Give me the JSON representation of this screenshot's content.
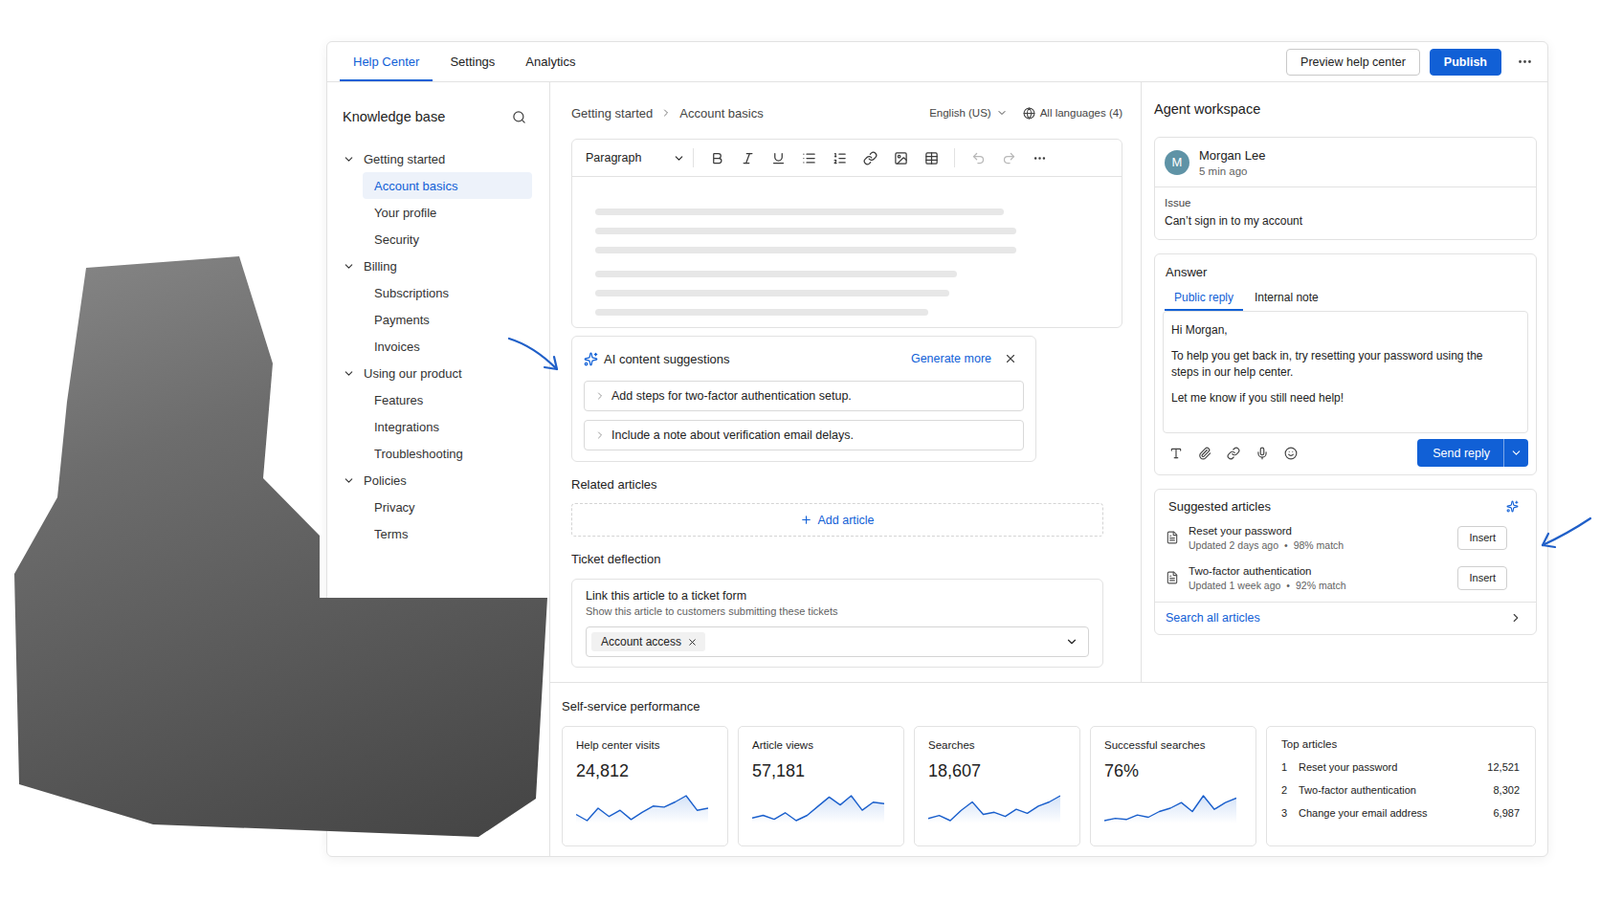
{
  "nav": {
    "tabs": [
      {
        "label": "Help Center",
        "selected": true
      },
      {
        "label": "Settings",
        "selected": false
      },
      {
        "label": "Analytics",
        "selected": false
      }
    ],
    "preview": "Preview help center",
    "publish": "Publish"
  },
  "sidebar": {
    "title": "Knowledge base",
    "groups": [
      {
        "label": "Getting started",
        "expanded": true,
        "items": [
          {
            "label": "Account basics",
            "selected": true
          },
          {
            "label": "Your profile",
            "selected": false
          },
          {
            "label": "Security",
            "selected": false
          }
        ]
      },
      {
        "label": "Billing",
        "expanded": true,
        "items": [
          {
            "label": "Subscriptions",
            "selected": false
          },
          {
            "label": "Payments",
            "selected": false
          },
          {
            "label": "Invoices",
            "selected": false
          }
        ]
      },
      {
        "label": "Using our product",
        "expanded": true,
        "items": [
          {
            "label": "Features",
            "selected": false
          },
          {
            "label": "Integrations",
            "selected": false
          },
          {
            "label": "Troubleshooting",
            "selected": false
          }
        ]
      },
      {
        "label": "Policies",
        "expanded": true,
        "items": [
          {
            "label": "Privacy",
            "selected": false
          },
          {
            "label": "Terms",
            "selected": false
          }
        ]
      }
    ]
  },
  "editor": {
    "breadcrumb": [
      "Getting started",
      "Account basics"
    ],
    "language": "English (US)",
    "languages": "All languages (4)",
    "block_style": "Paragraph",
    "tool_groups": [
      [
        {
          "kind": "bold",
          "disabled": false
        },
        {
          "kind": "italic",
          "disabled": false
        },
        {
          "kind": "underline",
          "disabled": false
        },
        {
          "kind": "bullets",
          "disabled": false
        },
        {
          "kind": "numbered",
          "disabled": false
        },
        {
          "kind": "link",
          "disabled": false
        },
        {
          "kind": "image",
          "disabled": false
        },
        {
          "kind": "table",
          "disabled": false
        }
      ],
      [
        {
          "kind": "undo",
          "disabled": true
        },
        {
          "kind": "redo",
          "disabled": true
        },
        {
          "kind": "more",
          "disabled": false
        }
      ]
    ],
    "placeholder_paragraphs": [
      [
        0.97,
        1.0,
        1.0
      ],
      [
        0.86,
        0.84,
        0.79
      ]
    ]
  },
  "ai_suggestions": {
    "title": "AI content suggestions",
    "action": "Generate more",
    "items": [
      "Add steps for two-factor authentication setup.",
      "Include a note about verification email delays."
    ]
  },
  "related": {
    "title": "Related articles",
    "action": "Add article"
  },
  "deflection": {
    "title": "Ticket deflection",
    "label": "Link this article to a ticket form",
    "hint": "Show this article to customers submitting these tickets",
    "chips": [
      "Account access"
    ]
  },
  "agent": {
    "title": "Agent workspace",
    "customer": {
      "initial": "M",
      "name": "Morgan Lee",
      "time": "5 min ago"
    },
    "issue_label": "Issue",
    "issue": "Can’t sign in to my account",
    "answer": {
      "title": "Answer",
      "tabs": [
        {
          "label": "Public reply",
          "selected": true
        },
        {
          "label": "Internal note",
          "selected": false
        }
      ],
      "paragraphs": [
        "Hi Morgan,",
        "To help you get back in, try resetting your password using the steps in our help center.",
        "Let me know if you still need help!"
      ],
      "send": "Send reply"
    },
    "suggested": {
      "title": "Suggested articles",
      "separator": "•",
      "items": [
        {
          "title": "Reset your password",
          "updated": "Updated 2 days ago",
          "match": "98% match",
          "action": "Insert"
        },
        {
          "title": "Two-factor authentication",
          "updated": "Updated 1 week ago",
          "match": "92% match",
          "action": "Insert"
        }
      ],
      "search": "Search all articles"
    }
  },
  "performance": {
    "title": "Self-service performance",
    "metrics": [
      {
        "label": "Help center visits",
        "value": "24,812",
        "series": [
          40,
          34,
          46,
          38,
          44,
          35,
          42,
          48,
          47,
          52,
          58,
          44,
          46
        ]
      },
      {
        "label": "Article views",
        "value": "57,181",
        "series": [
          38,
          40,
          37,
          42,
          36,
          40,
          47,
          54,
          48,
          55,
          44,
          50,
          49
        ]
      },
      {
        "label": "Searches",
        "value": "18,607",
        "series": [
          36,
          39,
          34,
          44,
          52,
          40,
          42,
          38,
          45,
          41,
          48,
          52,
          58
        ]
      },
      {
        "label": "Successful searches",
        "value": "76%",
        "series": [
          36,
          38,
          37,
          41,
          39,
          44,
          47,
          52,
          44,
          58,
          46,
          52,
          56
        ]
      }
    ],
    "top": {
      "title": "Top articles",
      "items": [
        {
          "rank": "1",
          "title": "Reset your password",
          "views": "12,521"
        },
        {
          "rank": "2",
          "title": "Two-factor authentication",
          "views": "8,302"
        },
        {
          "rank": "3",
          "title": "Change your email address",
          "views": "6,987"
        }
      ]
    }
  }
}
